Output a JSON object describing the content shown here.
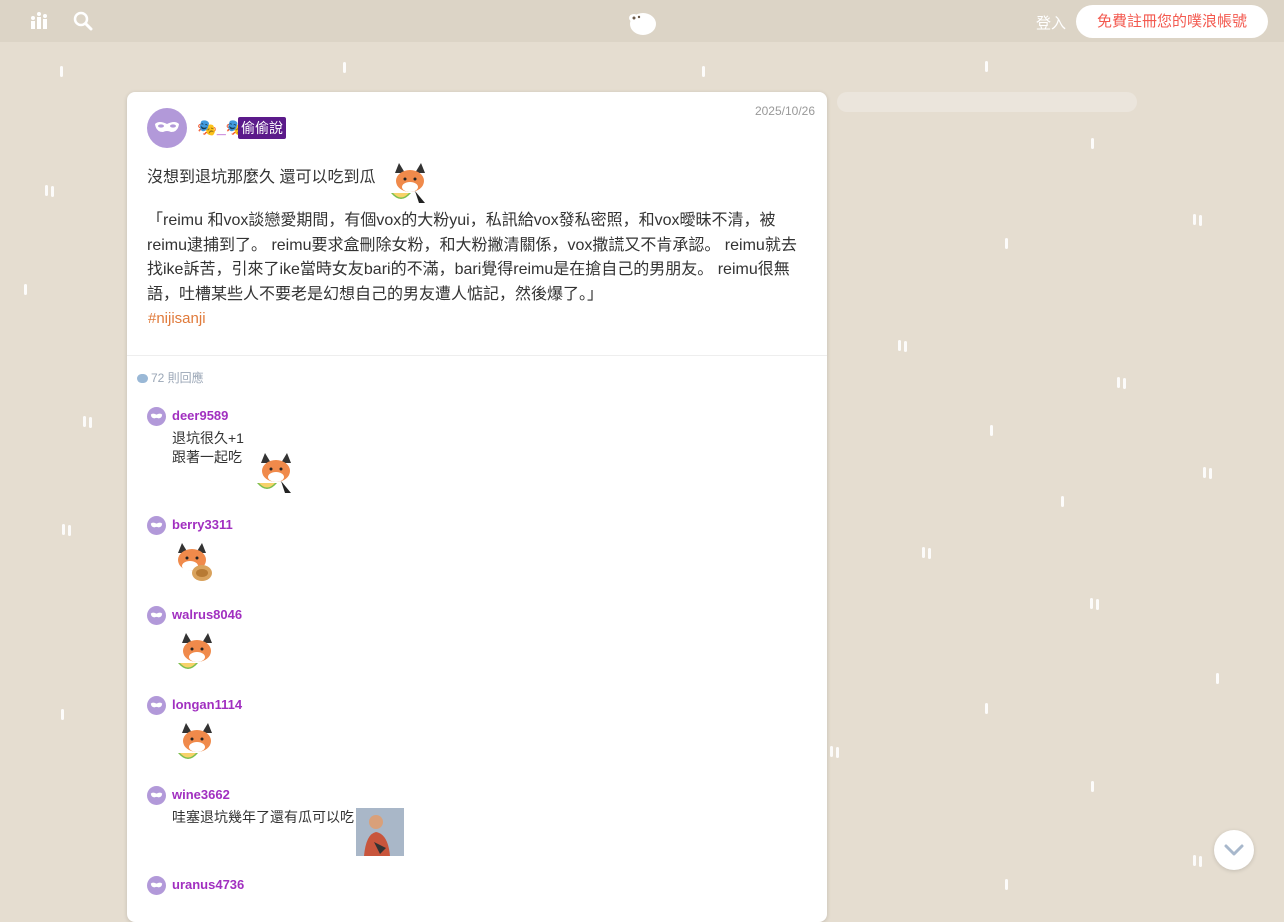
{
  "topbar": {
    "login_label": "登入",
    "signup_label": "免費註冊您的噗浪帳號",
    "icons": [
      "chart-icon",
      "search-icon",
      "plurk-logo-icon"
    ]
  },
  "post": {
    "name": "🎭_🎭",
    "badge": "偷偷說",
    "date": "2025/10/26",
    "line1": "沒想到退坑那麼久 還可以吃到瓜",
    "body": "「reimu 和vox談戀愛期間，有個vox的大粉yui，私訊給vox發私密照，和vox曖昧不清，被reimu逮捕到了。 reimu要求盒刪除女粉，和大粉撇清關係，vox撒謊又不肯承認。 reimu就去找ike訴苦，引來了ike當時女友bari的不滿，bari覺得reimu是在搶自己的男朋友。 reimu很無語，吐槽某些人不要老是幻想自己的男友遭人惦記，然後爆了。」",
    "hashtag": "#nijisanji",
    "reply_count": "72 則回應"
  },
  "replies": [
    {
      "name": "deer9589",
      "lines": [
        "退坑很久+1",
        "跟著一起吃"
      ]
    },
    {
      "name": "berry3311",
      "lines": []
    },
    {
      "name": "walrus8046",
      "lines": []
    },
    {
      "name": "longan1114",
      "lines": []
    },
    {
      "name": "wine3662",
      "lines": [
        "哇塞退坑幾年了還有瓜可以吃"
      ]
    },
    {
      "name": "uranus4736",
      "lines": []
    }
  ],
  "colors": {
    "background": "#e5ddd0",
    "topbar": "#dcd4c6",
    "username": "#a12fc0",
    "badge": "#5b1a8a",
    "hashtag": "#e07a3a",
    "signup_text": "#f35a50"
  }
}
